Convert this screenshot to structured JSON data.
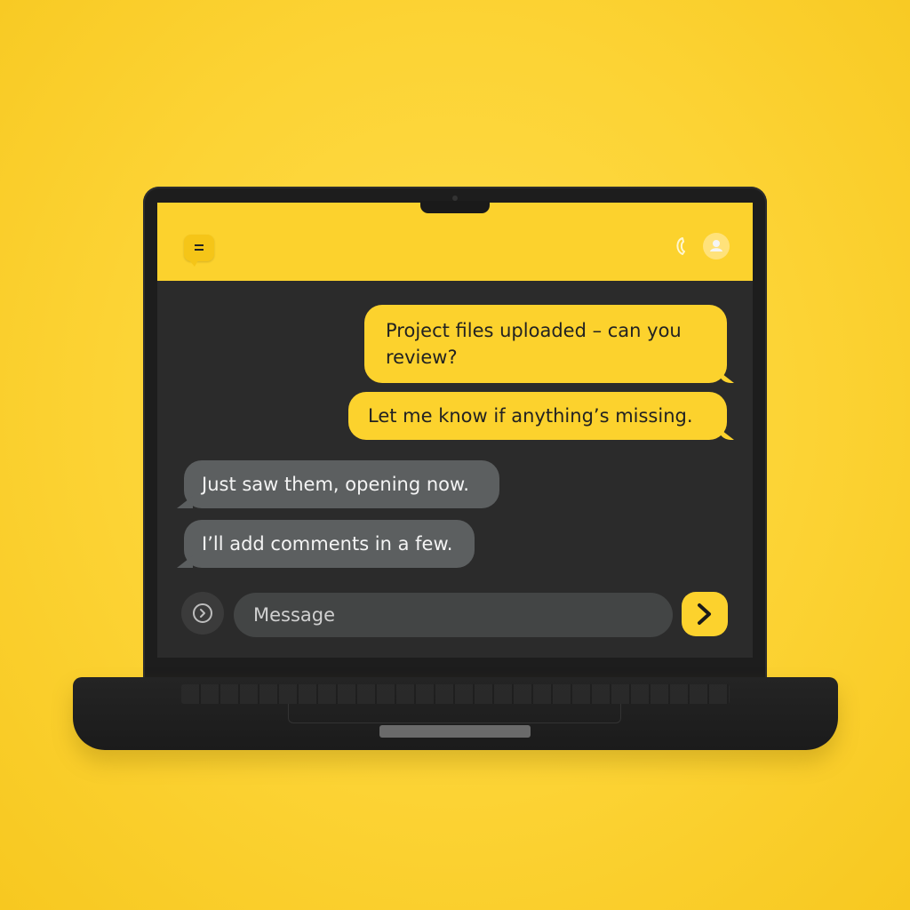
{
  "header": {
    "logo_icon": "chat-bubble-logo-icon",
    "phone_icon": "phone-icon",
    "avatar_icon": "user-avatar-icon"
  },
  "messages": [
    {
      "direction": "outgoing",
      "text": "Project files uploaded – can you review?"
    },
    {
      "direction": "outgoing",
      "text": "Let me know if anything’s missing."
    },
    {
      "direction": "incoming",
      "text": "Just saw them, opening now."
    },
    {
      "direction": "incoming",
      "text": "I’ll add comments in a few."
    }
  ],
  "composer": {
    "placeholder": "Message",
    "attach_icon": "circle-chevron-icon",
    "send_icon": "chevron-right-icon"
  },
  "colors": {
    "accent": "#fcd22d",
    "background": "#2b2b2b",
    "incoming_bubble": "#5c5f60"
  }
}
